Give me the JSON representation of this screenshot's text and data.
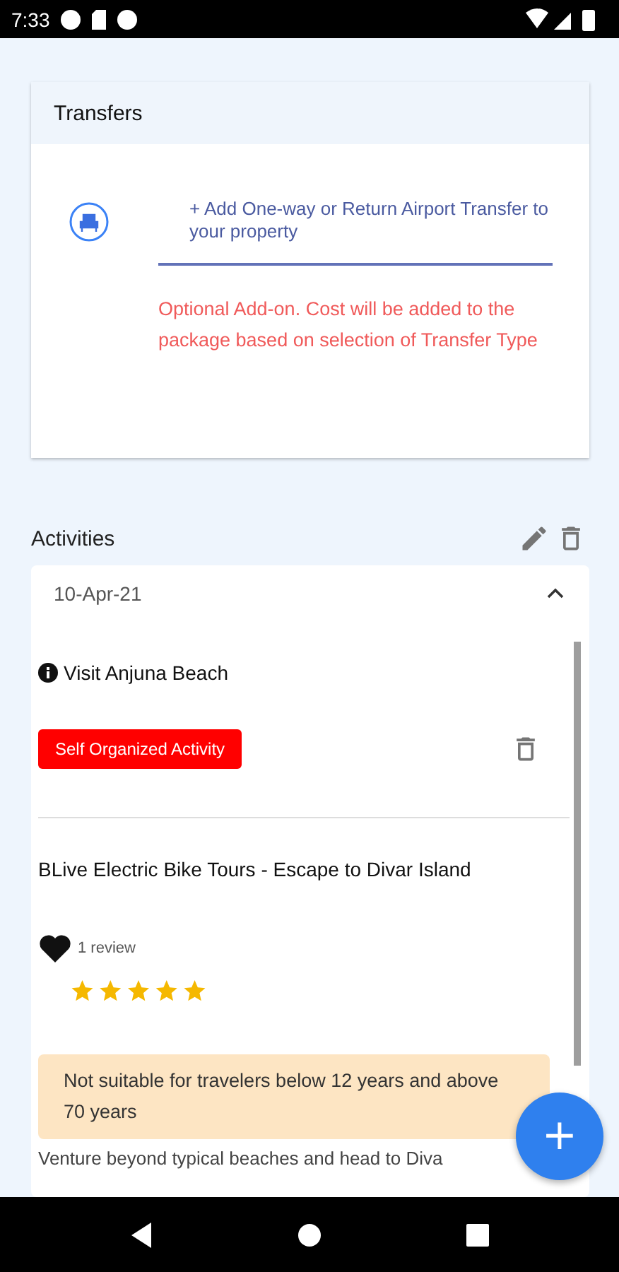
{
  "status_bar": {
    "time": "7:33"
  },
  "transfers": {
    "title": "Transfers",
    "add_link": "+ Add One-way or Return Airport Transfer to your property",
    "note": "Optional Add-on. Cost will be added to the package based on selection of Transfer Type"
  },
  "activities": {
    "title": "Activities",
    "day": {
      "date": "10-Apr-21",
      "expanded": true,
      "items": [
        {
          "kind": "self",
          "title": "Visit Anjuna Beach",
          "tag": "Self Organized Activity"
        },
        {
          "kind": "tour",
          "title": "BLive Electric Bike Tours - Escape to Divar Island",
          "reviews": "1 review",
          "stars": 5,
          "warning": "Not suitable for travelers below 12 years and above 70 years",
          "description": "Venture beyond typical beaches and head to Diva"
        }
      ]
    }
  },
  "fab": {
    "label": "+"
  }
}
